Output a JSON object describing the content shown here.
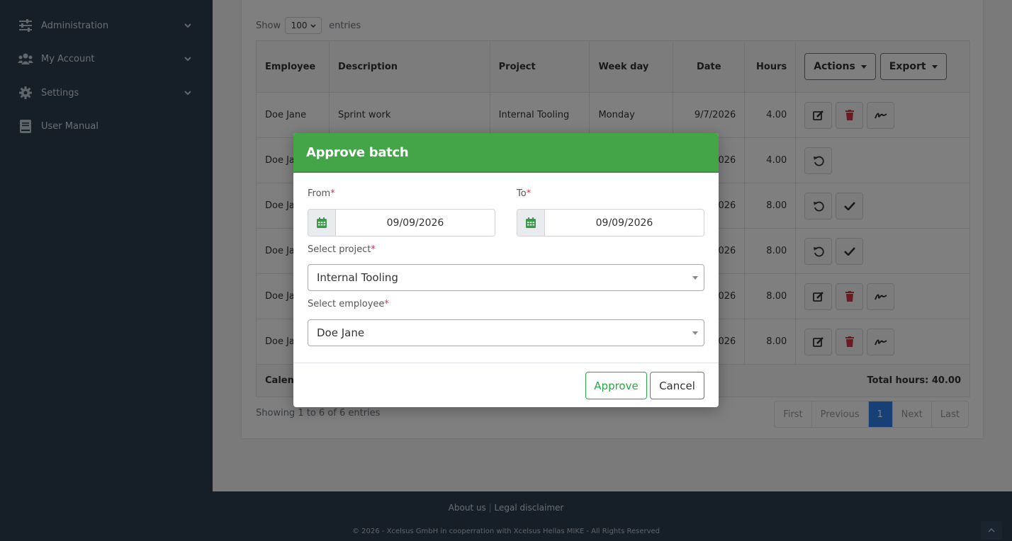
{
  "sidebar": {
    "items": [
      {
        "label": "Administration",
        "icon": "sliders-icon",
        "has_children": true
      },
      {
        "label": "My Account",
        "icon": "users-icon",
        "has_children": true
      },
      {
        "label": "Settings",
        "icon": "gear-icon",
        "has_children": true
      },
      {
        "label": "User Manual",
        "icon": "book-icon",
        "has_children": false
      }
    ]
  },
  "table_controls": {
    "show_label": "Show",
    "page_length": "100",
    "entries_label": "entries"
  },
  "table": {
    "headers": {
      "employee": "Employee",
      "description": "Description",
      "project": "Project",
      "weekday": "Week day",
      "date": "Date",
      "hours": "Hours"
    },
    "actions_label": "Actions",
    "export_label": "Export",
    "rows": [
      {
        "employee": "Doe Jane",
        "description": "Sprint work",
        "project": "Internal Tooling",
        "weekday": "Monday",
        "date": "9/7/2026",
        "hours": "4.00",
        "actions": [
          "edit",
          "delete",
          "sign"
        ]
      },
      {
        "employee": "Doe Ja",
        "description": "",
        "project": "",
        "weekday": "",
        "date": "026",
        "hours": "4.00",
        "actions": [
          "revert"
        ]
      },
      {
        "employee": "Doe Ja",
        "description": "",
        "project": "",
        "weekday": "",
        "date": "026",
        "hours": "8.00",
        "actions": [
          "revert",
          "approve"
        ]
      },
      {
        "employee": "Doe Ja",
        "description": "",
        "project": "",
        "weekday": "",
        "date": "026",
        "hours": "8.00",
        "actions": [
          "revert",
          "approve"
        ]
      },
      {
        "employee": "Doe Ja",
        "description": "",
        "project": "",
        "weekday": "",
        "date": "026",
        "hours": "8.00",
        "actions": [
          "edit",
          "delete",
          "sign"
        ]
      },
      {
        "employee": "Doe Ja",
        "description": "",
        "project": "",
        "weekday": "",
        "date": "026",
        "hours": "8.00",
        "actions": [
          "edit",
          "delete",
          "sign"
        ]
      }
    ],
    "footer_left": "Calen",
    "total_label": "Total hours: 40.00"
  },
  "table_info": "Showing 1 to 6 of 6 entries",
  "pagination": {
    "first": "First",
    "previous": "Previous",
    "current": "1",
    "next": "Next",
    "last": "Last"
  },
  "footer": {
    "about": "About us",
    "separator": "|",
    "legal": "Legal disclaimer",
    "copyright": "© 2026 - Xcelsus GmbH in cooperration with Xcelsus Hellas MIKE - All Rights Reserved"
  },
  "modal": {
    "title": "Approve batch",
    "from_label": "From",
    "from_value": "09/09/2026",
    "to_label": "To",
    "to_value": "09/09/2026",
    "project_label": "Select project",
    "project_value": "Internal Tooling",
    "employee_label": "Select employee",
    "employee_value": "Doe Jane",
    "required_mark": "*",
    "approve_label": "Approve",
    "cancel_label": "Cancel"
  },
  "colors": {
    "sidebar_bg": "#2c3e50",
    "modal_header": "#43a547",
    "approve": "#28a745",
    "delete": "#dc3545",
    "page_active": "#2f80ed"
  }
}
